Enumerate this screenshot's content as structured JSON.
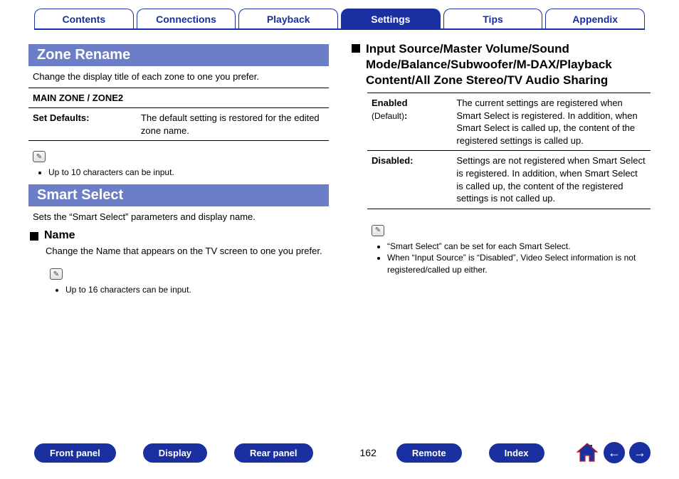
{
  "tabs": {
    "items": [
      {
        "label": "Contents"
      },
      {
        "label": "Connections"
      },
      {
        "label": "Playback"
      },
      {
        "label": "Settings",
        "active": true
      },
      {
        "label": "Tips"
      },
      {
        "label": "Appendix"
      }
    ]
  },
  "left": {
    "zone_rename": {
      "title": "Zone Rename",
      "desc": "Change the display title of each zone to one you prefer.",
      "table_header": "MAIN ZONE / ZONE2",
      "row_label": "Set Defaults:",
      "row_value": "The default setting is restored for the edited zone name.",
      "note": "Up to 10 characters can be input."
    },
    "smart_select": {
      "title": "Smart Select",
      "desc": "Sets the “Smart Select” parameters and display name.",
      "name_heading": "Name",
      "name_desc": "Change the Name that appears on the TV screen to one you prefer.",
      "note": "Up to 16 characters can be input."
    }
  },
  "right": {
    "heading": "Input Source/Master Volume/Sound Mode/Balance/Subwoofer/M-DAX/Playback Content/All Zone Stereo/TV Audio Sharing",
    "rows": [
      {
        "label": "Enabled",
        "sublabel": "(Default)",
        "colon": ":",
        "value": "The current settings are registered when Smart Select is registered. In addition, when Smart Select is called up, the content of the registered settings is called up."
      },
      {
        "label": "Disabled:",
        "value": "Settings are not registered when Smart Select is registered. In addition, when Smart Select is called up, the content of the registered settings is not called up."
      }
    ],
    "notes": [
      "“Smart Select” can be set for each Smart Select.",
      "When “Input Source” is “Disabled”, Video Select information is not registered/called up either."
    ]
  },
  "footer": {
    "buttons": [
      "Front panel",
      "Display",
      "Rear panel"
    ],
    "page": "162",
    "buttons2": [
      "Remote",
      "Index"
    ]
  }
}
